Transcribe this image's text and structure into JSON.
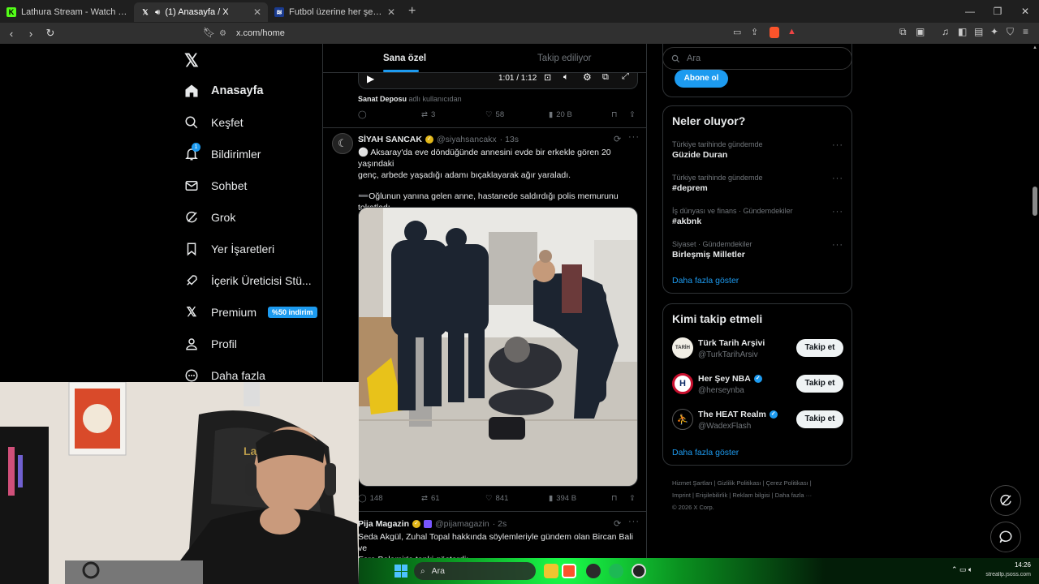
{
  "browser": {
    "tabs": [
      {
        "label": "Lathura Stream - Watch Live on Kick",
        "fav": "K",
        "fav_color": "#53fc18"
      },
      {
        "label": "(1) Anasayfa / X",
        "fav": "X",
        "fav_color": "#ffffff",
        "active": true
      },
      {
        "label": "Futbol üzerine her şey: Piyasa Değerl",
        "fav": "≋",
        "fav_color": "#1a3b8f"
      }
    ],
    "url": "x.com/home"
  },
  "nav": {
    "items": [
      {
        "label": "Anasayfa",
        "icon": "home-icon"
      },
      {
        "label": "Keşfet",
        "icon": "search-icon"
      },
      {
        "label": "Bildirimler",
        "icon": "bell-icon"
      },
      {
        "label": "Sohbet",
        "icon": "mail-icon"
      },
      {
        "label": "Grok",
        "icon": "grok-icon"
      },
      {
        "label": "Yer İşaretleri",
        "icon": "bookmark-icon"
      },
      {
        "label": "İçerik Üreticisi Stü...",
        "icon": "rocket-icon"
      },
      {
        "label": "Premium",
        "icon": "x-logo-icon"
      },
      {
        "label": "Profil",
        "icon": "person-icon"
      },
      {
        "label": "Daha fazla",
        "icon": "more-circle-icon"
      }
    ],
    "notifications_count": "1",
    "premium_badge": "%50 indirim"
  },
  "timeline": {
    "tabs": [
      "Sana özel",
      "Takip ediliyor"
    ],
    "video_time": "1:01 / 1:12",
    "prev_tweet": {
      "source_name": "Sanat Deposu",
      "source_suffix": "adlı kullanıcıdan",
      "replies": "",
      "retweets": "3",
      "likes": "58",
      "views": "20 B"
    },
    "tweet": {
      "author": "SİYAH SANCAK",
      "handle": "@siyahsancakx",
      "time": "· 13s",
      "line1": "⚪ Aksaray'da eve döndüğünde annesini evde bir erkekle gören 20 yaşındaki",
      "line2": "genç, arbede yaşadığı adamı bıçaklayarak ağır yaraladı.",
      "line3": "➖Oğlunun yanına gelen anne, hastanede saldırdığı polis memurunu",
      "line4": "tokatladı.",
      "replies": "148",
      "retweets": "61",
      "likes": "841",
      "views": "394 B"
    },
    "next_tweet": {
      "author": "Pija Magazin",
      "handle": "@pijamagazin",
      "time": "· 2s",
      "line1": "Seda Akgül, Zuhal Topal hakkında söylemleriyle gündem olan Bircan Bali ve",
      "line2": "Esra Balamir'e tepki gösterdi:"
    }
  },
  "right": {
    "search_placeholder": "Ara",
    "subscribe_label": "Abone ol",
    "trends_title": "Neler oluyor?",
    "trends": [
      {
        "sub": "Türkiye tarihinde gündemde",
        "name": "Güzide Duran"
      },
      {
        "sub": "Türkiye tarihinde gündemde",
        "name": "#deprem"
      },
      {
        "sub": "İş dünyası ve finans · Gündemdekiler",
        "name": "#akbnk"
      },
      {
        "sub": "Siyaset · Gündemdekiler",
        "name": "Birleşmiş Milletler"
      }
    ],
    "show_more": "Daha fazla göster",
    "follow_title": "Kimi takip etmeli",
    "follow": [
      {
        "name": "Türk Tarih Arşivi",
        "handle": "@TurkTarihArsiv",
        "verified": false
      },
      {
        "name": "Her Şey NBA",
        "handle": "@herseynba",
        "verified": true
      },
      {
        "name": "The HEAT Realm",
        "handle": "@WadexFlash",
        "verified": true
      }
    ],
    "follow_button": "Takip et",
    "footer_line1": "Hizmet Şartları  |  Gizlilik Politikası  |  Çerez Politikası  |",
    "footer_line2": "Imprint  |  Erişilebilirlik  |  Reklam bilgisi  |  Daha fazla ···",
    "footer_line3": "© 2026 X Corp."
  },
  "taskbar": {
    "search_placeholder": "Ara",
    "time": "14:26",
    "watermark": "streallp.jsoss.com"
  }
}
